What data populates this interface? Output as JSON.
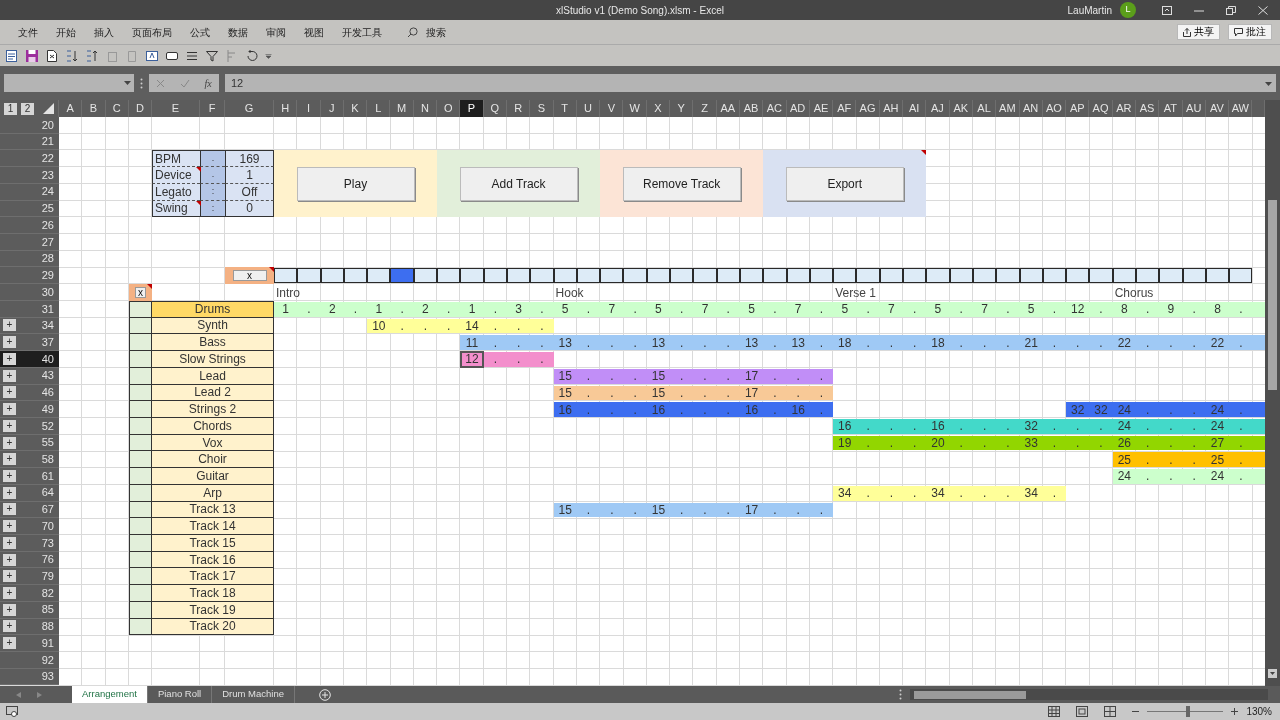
{
  "window": {
    "title": "xlStudio v1 (Demo Song).xlsm  -  Excel",
    "user": "LauMartin",
    "avatar": "L"
  },
  "menu": [
    "文件",
    "开始",
    "插入",
    "页面布局",
    "公式",
    "数据",
    "审阅",
    "视图",
    "开发工具"
  ],
  "search": {
    "label": "搜索"
  },
  "ribbon_actions": [
    {
      "kind": "share",
      "label": "共享"
    },
    {
      "kind": "comments",
      "label": "批注"
    }
  ],
  "formula_bar": {
    "function_label": "fx",
    "value": "12"
  },
  "outline_levels": [
    "1",
    "2"
  ],
  "columns": [
    {
      "label": "A",
      "selected": false
    },
    {
      "label": "B",
      "selected": false
    },
    {
      "label": "C",
      "selected": false
    },
    {
      "label": "D",
      "selected": false
    },
    {
      "label": "E",
      "selected": false
    },
    {
      "label": "F",
      "selected": false
    },
    {
      "label": "G",
      "selected": false
    },
    {
      "label": "H",
      "selected": false
    },
    {
      "label": "I",
      "selected": false
    },
    {
      "label": "J",
      "selected": false
    },
    {
      "label": "K",
      "selected": false
    },
    {
      "label": "L",
      "selected": false
    },
    {
      "label": "M",
      "selected": false
    },
    {
      "label": "N",
      "selected": false
    },
    {
      "label": "O",
      "selected": false
    },
    {
      "label": "P",
      "selected": true
    },
    {
      "label": "Q",
      "selected": false
    },
    {
      "label": "R",
      "selected": false
    },
    {
      "label": "S",
      "selected": false
    },
    {
      "label": "T",
      "selected": false
    },
    {
      "label": "U",
      "selected": false
    },
    {
      "label": "V",
      "selected": false
    },
    {
      "label": "W",
      "selected": false
    },
    {
      "label": "X",
      "selected": false
    },
    {
      "label": "Y",
      "selected": false
    },
    {
      "label": "Z",
      "selected": false
    },
    {
      "label": "AA",
      "selected": false
    },
    {
      "label": "AB",
      "selected": false
    },
    {
      "label": "AC",
      "selected": false
    },
    {
      "label": "AD",
      "selected": false
    },
    {
      "label": "AE",
      "selected": false
    },
    {
      "label": "AF",
      "selected": false
    },
    {
      "label": "AG",
      "selected": false
    },
    {
      "label": "AH",
      "selected": false
    },
    {
      "label": "AI",
      "selected": false
    },
    {
      "label": "AJ",
      "selected": false
    },
    {
      "label": "AK",
      "selected": false
    },
    {
      "label": "AL",
      "selected": false
    },
    {
      "label": "AM",
      "selected": false
    },
    {
      "label": "AN",
      "selected": false
    },
    {
      "label": "AO",
      "selected": false
    },
    {
      "label": "AP",
      "selected": false
    },
    {
      "label": "AQ",
      "selected": false
    },
    {
      "label": "AR",
      "selected": false
    },
    {
      "label": "AS",
      "selected": false
    },
    {
      "label": "AT",
      "selected": false
    },
    {
      "label": "AU",
      "selected": false
    },
    {
      "label": "AV",
      "selected": false
    },
    {
      "label": "AW",
      "selected": false
    }
  ],
  "rows": [
    {
      "label": "20",
      "selected": false
    },
    {
      "label": "21",
      "selected": false
    },
    {
      "label": "22",
      "selected": false
    },
    {
      "label": "23",
      "selected": false
    },
    {
      "label": "24",
      "selected": false
    },
    {
      "label": "25",
      "selected": false
    },
    {
      "label": "26",
      "selected": false
    },
    {
      "label": "27",
      "selected": false
    },
    {
      "label": "28",
      "selected": false
    },
    {
      "label": "29",
      "selected": false
    },
    {
      "label": "30",
      "selected": false
    },
    {
      "label": "31",
      "selected": false
    },
    {
      "label": "34",
      "selected": false,
      "outline": "+"
    },
    {
      "label": "37",
      "selected": false,
      "outline": "+"
    },
    {
      "label": "40",
      "selected": true,
      "outline": "+"
    },
    {
      "label": "43",
      "selected": false,
      "outline": "+"
    },
    {
      "label": "46",
      "selected": false,
      "outline": "+"
    },
    {
      "label": "49",
      "selected": false,
      "outline": "+"
    },
    {
      "label": "52",
      "selected": false,
      "outline": "+"
    },
    {
      "label": "55",
      "selected": false,
      "outline": "+"
    },
    {
      "label": "58",
      "selected": false,
      "outline": "+"
    },
    {
      "label": "61",
      "selected": false,
      "outline": "+"
    },
    {
      "label": "64",
      "selected": false,
      "outline": "+"
    },
    {
      "label": "67",
      "selected": false,
      "outline": "+"
    },
    {
      "label": "70",
      "selected": false,
      "outline": "+"
    },
    {
      "label": "73",
      "selected": false,
      "outline": "+"
    },
    {
      "label": "76",
      "selected": false,
      "outline": "+"
    },
    {
      "label": "79",
      "selected": false,
      "outline": "+"
    },
    {
      "label": "82",
      "selected": false,
      "outline": "+"
    },
    {
      "label": "85",
      "selected": false,
      "outline": "+"
    },
    {
      "label": "88",
      "selected": false,
      "outline": "+"
    },
    {
      "label": "91",
      "selected": false,
      "outline": "+"
    },
    {
      "label": "92",
      "selected": false
    },
    {
      "label": "93",
      "selected": false
    }
  ],
  "settings": [
    {
      "label": "BPM",
      "separator": ".",
      "value": "169",
      "comment": false
    },
    {
      "label": "Device",
      "separator": ".",
      "value": "1",
      "comment": true
    },
    {
      "label": "Legato",
      "separator": ":",
      "value": "Off",
      "comment": false
    },
    {
      "label": "Swing",
      "separator": ":",
      "value": "0",
      "comment": true
    }
  ],
  "buttons": [
    {
      "label": "Play",
      "color": "#fff2cc",
      "comment": false
    },
    {
      "label": "Add Track",
      "color": "#e2efda",
      "comment": false
    },
    {
      "label": "Remove Track",
      "color": "#fce4d6",
      "comment": false
    },
    {
      "label": "Export",
      "color": "#d9e1f2",
      "comment": true
    }
  ],
  "pattern_bar": {
    "button": "x",
    "comment": true,
    "slots": [
      {
        "selected": false
      },
      {
        "selected": false
      },
      {
        "selected": false
      },
      {
        "selected": false
      },
      {
        "selected": false
      },
      {
        "selected": true
      },
      {
        "selected": false
      },
      {
        "selected": false
      },
      {
        "selected": false
      },
      {
        "selected": false
      },
      {
        "selected": false
      },
      {
        "selected": false
      },
      {
        "selected": false
      },
      {
        "selected": false
      },
      {
        "selected": false
      },
      {
        "selected": false
      },
      {
        "selected": false
      },
      {
        "selected": false
      },
      {
        "selected": false
      },
      {
        "selected": false
      },
      {
        "selected": false
      },
      {
        "selected": false
      },
      {
        "selected": false
      },
      {
        "selected": false
      },
      {
        "selected": false
      },
      {
        "selected": false
      },
      {
        "selected": false
      },
      {
        "selected": false
      },
      {
        "selected": false
      },
      {
        "selected": false
      },
      {
        "selected": false
      },
      {
        "selected": false
      },
      {
        "selected": false
      },
      {
        "selected": false
      },
      {
        "selected": false
      },
      {
        "selected": false
      },
      {
        "selected": false
      },
      {
        "selected": false
      },
      {
        "selected": false
      },
      {
        "selected": false
      },
      {
        "selected": false
      },
      {
        "selected": false
      }
    ]
  },
  "sections": [
    "Intro",
    "Hook",
    "Verse 1",
    "Chorus"
  ],
  "track_list": {
    "button": "x",
    "comment": true
  },
  "tracks": [
    {
      "name": "Drums",
      "selected": true,
      "segments": [
        {
          "color": "#ccffcc",
          "cells": [
            "1",
            ".",
            "2",
            ".",
            "1",
            ".",
            "2",
            ".",
            "1",
            ".",
            "3",
            ".",
            "5",
            ".",
            "7",
            ".",
            "5",
            ".",
            "7",
            ".",
            "5",
            ".",
            "7",
            ".",
            "5",
            ".",
            "7",
            ".",
            "5",
            ".",
            "7",
            ".",
            "5",
            ".",
            "12",
            ".",
            "8",
            ".",
            "9",
            ".",
            "8",
            "."
          ]
        }
      ]
    },
    {
      "name": "Synth",
      "selected": false,
      "segments": [
        {
          "cells": [
            null,
            null,
            null,
            null
          ]
        },
        {
          "color": "#ffff99",
          "cells": [
            "10",
            ".",
            ".",
            ".",
            "14",
            ".",
            ".",
            "."
          ]
        }
      ]
    },
    {
      "name": "Bass",
      "selected": false,
      "segments": [
        {
          "cells": [
            null,
            null,
            null,
            null,
            null,
            null,
            null,
            null
          ]
        },
        {
          "color": "#9fc9f5",
          "cells": [
            "11",
            ".",
            ".",
            ".",
            "13",
            ".",
            ".",
            ".",
            "13",
            ".",
            ".",
            ".",
            "13",
            ".",
            "13",
            ".",
            "18",
            ".",
            ".",
            ".",
            "18",
            ".",
            ".",
            ".",
            "21",
            ".",
            ".",
            ".",
            "22",
            ".",
            ".",
            ".",
            "22",
            "."
          ]
        }
      ]
    },
    {
      "name": "Slow Strings",
      "selected": false,
      "segments": [
        {
          "cells": [
            null,
            null,
            null,
            null,
            null,
            null,
            null,
            null
          ]
        },
        {
          "color": "#f38fcc",
          "active": true,
          "cells": [
            "12",
            ".",
            ".",
            "."
          ]
        }
      ]
    },
    {
      "name": "Lead",
      "selected": false,
      "segments": [
        {
          "cells": [
            null,
            null,
            null,
            null,
            null,
            null,
            null,
            null,
            null,
            null,
            null,
            null
          ]
        },
        {
          "color": "#c18ef7",
          "cells": [
            "15",
            ".",
            ".",
            ".",
            "15",
            ".",
            ".",
            ".",
            "17",
            ".",
            ".",
            "."
          ]
        }
      ]
    },
    {
      "name": "Lead 2",
      "selected": false,
      "segments": [
        {
          "cells": [
            null,
            null,
            null,
            null,
            null,
            null,
            null,
            null,
            null,
            null,
            null,
            null
          ]
        },
        {
          "color": "#f8c997",
          "cells": [
            "15",
            ".",
            ".",
            ".",
            "15",
            ".",
            ".",
            ".",
            "17",
            ".",
            ".",
            "."
          ]
        }
      ]
    },
    {
      "name": "Strings 2",
      "selected": false,
      "segments": [
        {
          "cells": [
            null,
            null,
            null,
            null,
            null,
            null,
            null,
            null,
            null,
            null,
            null,
            null
          ]
        },
        {
          "color": "#3d6ef0",
          "cells": [
            "16",
            ".",
            ".",
            ".",
            "16",
            ".",
            ".",
            ".",
            "16",
            ".",
            "16",
            "."
          ]
        },
        {
          "cells": [
            null,
            null,
            null,
            null,
            null,
            null,
            null,
            null,
            null,
            null
          ]
        },
        {
          "color": "#3d6ef0",
          "cells": [
            "32",
            "32",
            "24",
            ".",
            ".",
            ".",
            "24",
            "."
          ]
        }
      ]
    },
    {
      "name": "Chords",
      "selected": false,
      "segments": [
        {
          "cells": [
            null,
            null,
            null,
            null,
            null,
            null,
            null,
            null,
            null,
            null,
            null,
            null,
            null,
            null,
            null,
            null,
            null,
            null,
            null,
            null,
            null,
            null,
            null,
            null
          ]
        },
        {
          "color": "#43d9c9",
          "cells": [
            "16",
            ".",
            ".",
            ".",
            "16",
            ".",
            ".",
            ".",
            "32",
            ".",
            ".",
            ".",
            "24",
            ".",
            ".",
            ".",
            "24",
            "."
          ]
        }
      ]
    },
    {
      "name": "Vox",
      "selected": false,
      "segments": [
        {
          "cells": [
            null,
            null,
            null,
            null,
            null,
            null,
            null,
            null,
            null,
            null,
            null,
            null,
            null,
            null,
            null,
            null,
            null,
            null,
            null,
            null,
            null,
            null,
            null,
            null
          ]
        },
        {
          "color": "#92d600",
          "cells": [
            "19",
            ".",
            ".",
            ".",
            "20",
            ".",
            ".",
            ".",
            "33",
            ".",
            ".",
            ".",
            "26",
            ".",
            ".",
            ".",
            "27",
            "."
          ]
        }
      ]
    },
    {
      "name": "Choir",
      "selected": false,
      "segments": [
        {
          "cells": [
            null,
            null,
            null,
            null,
            null,
            null,
            null,
            null,
            null,
            null,
            null,
            null,
            null,
            null,
            null,
            null,
            null,
            null,
            null,
            null,
            null,
            null,
            null,
            null,
            null,
            null,
            null,
            null,
            null,
            null,
            null,
            null,
            null,
            null,
            null,
            null
          ]
        },
        {
          "color": "#ffc000",
          "cells": [
            "25",
            ".",
            ".",
            ".",
            "25",
            "."
          ]
        }
      ]
    },
    {
      "name": "Guitar",
      "selected": false,
      "segments": [
        {
          "cells": [
            null,
            null,
            null,
            null,
            null,
            null,
            null,
            null,
            null,
            null,
            null,
            null,
            null,
            null,
            null,
            null,
            null,
            null,
            null,
            null,
            null,
            null,
            null,
            null,
            null,
            null,
            null,
            null,
            null,
            null,
            null,
            null,
            null,
            null,
            null,
            null
          ]
        },
        {
          "color": "#ccffcc",
          "cells": [
            "24",
            ".",
            ".",
            ".",
            "24",
            "."
          ]
        }
      ]
    },
    {
      "name": "Arp",
      "selected": false,
      "segments": [
        {
          "cells": [
            null,
            null,
            null,
            null,
            null,
            null,
            null,
            null,
            null,
            null,
            null,
            null,
            null,
            null,
            null,
            null,
            null,
            null,
            null,
            null,
            null,
            null,
            null,
            null
          ]
        },
        {
          "color": "#ffff99",
          "cells": [
            "34",
            ".",
            ".",
            ".",
            "34",
            ".",
            ".",
            ".",
            "34",
            "."
          ]
        }
      ]
    },
    {
      "name": "Track 13",
      "selected": false,
      "segments": [
        {
          "cells": [
            null,
            null,
            null,
            null,
            null,
            null,
            null,
            null,
            null,
            null,
            null,
            null
          ]
        },
        {
          "color": "#9fc9f5",
          "cells": [
            "15",
            ".",
            ".",
            ".",
            "15",
            ".",
            ".",
            ".",
            "17",
            ".",
            ".",
            "."
          ]
        }
      ]
    },
    {
      "name": "Track 14",
      "selected": false
    },
    {
      "name": "Track 15",
      "selected": false
    },
    {
      "name": "Track 16",
      "selected": false
    },
    {
      "name": "Track 17",
      "selected": false
    },
    {
      "name": "Track 18",
      "selected": false
    },
    {
      "name": "Track 19",
      "selected": false
    },
    {
      "name": "Track 20",
      "selected": false
    }
  ],
  "sheets": [
    {
      "label": "Arrangement",
      "selected": true
    },
    {
      "label": "Piano Roll",
      "selected": false
    },
    {
      "label": "Drum Machine",
      "selected": false
    }
  ],
  "status_bar": {
    "zoom": {
      "label": "130%",
      "level": 0.53
    }
  }
}
